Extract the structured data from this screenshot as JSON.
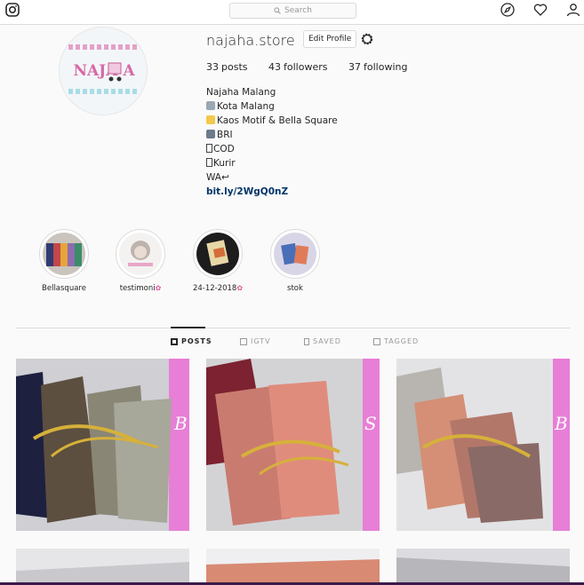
{
  "search": {
    "placeholder": "Search"
  },
  "profile": {
    "username": "najaha.store",
    "edit_label": "Edit Profile",
    "avatar_text": "NAJA A",
    "stats": {
      "posts": "33",
      "posts_label": "posts",
      "followers": "43",
      "followers_label": "followers",
      "following": "37",
      "following_label": "following"
    },
    "bio": {
      "name": "Najaha Malang",
      "line1": "Kota Malang",
      "line2": "Kaos Motif & Bella Square",
      "line3": "BRI",
      "line4": "COD",
      "line5": "Kurir",
      "line6": "WA",
      "link": "bit.ly/2WgQ0nZ"
    }
  },
  "highlights": [
    {
      "label": "Bellasquare"
    },
    {
      "label": "testimoni"
    },
    {
      "label": "24-12-2018"
    },
    {
      "label": "stok"
    }
  ],
  "tabs": [
    {
      "label": "POSTS"
    },
    {
      "label": "IGTV"
    },
    {
      "label": "SAVED"
    },
    {
      "label": "TAGGED"
    }
  ],
  "colors": {
    "accent": "#262626",
    "link": "#003569",
    "banner_pink": "#e77fd6"
  }
}
